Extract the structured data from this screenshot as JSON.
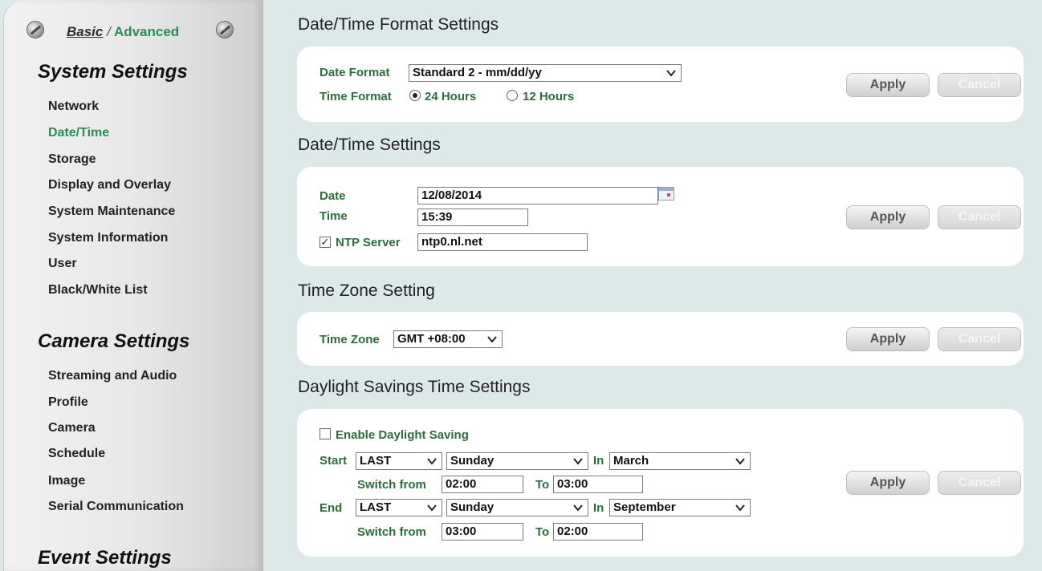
{
  "sidebar": {
    "mode": {
      "basic": "Basic",
      "separator": "/",
      "advanced": "Advanced"
    },
    "system_heading": "System Settings",
    "system_items": [
      "Network",
      "Date/Time",
      "Storage",
      "Display and Overlay",
      "System Maintenance",
      "System Information",
      "User",
      "Black/White List"
    ],
    "camera_heading": "Camera Settings",
    "camera_items": [
      "Streaming and Audio",
      "Profile",
      "Camera",
      "Schedule",
      "Image",
      "Serial Communication"
    ],
    "event_heading": "Event Settings",
    "active_item": "Date/Time"
  },
  "format_section": {
    "title": "Date/Time Format Settings",
    "date_format_label": "Date Format",
    "date_format_value": "Standard 2 - mm/dd/yy",
    "time_format_label": "Time Format",
    "time_24": "24 Hours",
    "time_12": "12 Hours",
    "selected_time_format": "24 Hours"
  },
  "datetime_section": {
    "title": "Date/Time Settings",
    "date_label": "Date",
    "date_value": "12/08/2014",
    "time_label": "Time",
    "time_value": "15:39",
    "ntp_label": "NTP Server",
    "ntp_checked": true,
    "ntp_value": "ntp0.nl.net"
  },
  "timezone_section": {
    "title": "Time Zone Setting",
    "tz_label": "Time Zone",
    "tz_value": "GMT +08:00"
  },
  "dst_section": {
    "title": "Daylight Savings Time Settings",
    "enable_label": "Enable Daylight Saving",
    "enable_checked": false,
    "start_label": "Start",
    "end_label": "End",
    "in_label": "In",
    "switch_from_label": "Switch from",
    "to_label": "To",
    "start": {
      "week": "LAST",
      "day": "Sunday",
      "month": "March",
      "from": "02:00",
      "to": "03:00"
    },
    "end": {
      "week": "LAST",
      "day": "Sunday",
      "month": "September",
      "from": "03:00",
      "to": "02:00"
    }
  },
  "buttons": {
    "apply": "Apply",
    "cancel": "Cancel"
  }
}
